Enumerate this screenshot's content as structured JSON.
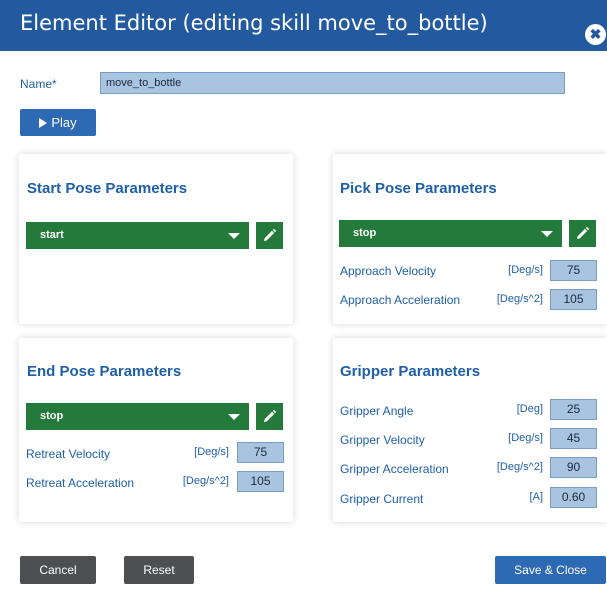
{
  "window": {
    "title": "Element Editor (editing skill move_to_bottle)",
    "close_glyph": "✖"
  },
  "name_field": {
    "label": "Name*",
    "value": "move_to_bottle"
  },
  "play_button": {
    "label": "Play",
    "icon": "play-icon"
  },
  "start_pose": {
    "title": "Start Pose Parameters",
    "selected": "start",
    "edit_icon": "pencil-icon"
  },
  "pick_pose": {
    "title": "Pick Pose Parameters",
    "selected": "stop",
    "edit_icon": "pencil-icon",
    "params": [
      {
        "label": "Approach Velocity",
        "unit": "[Deg/s]",
        "value": "75"
      },
      {
        "label": "Approach Acceleration",
        "unit": "[Deg/s^2]",
        "value": "105"
      }
    ]
  },
  "end_pose": {
    "title": "End Pose Parameters",
    "selected": "stop",
    "edit_icon": "pencil-icon",
    "params": [
      {
        "label": "Retreat Velocity",
        "unit": "[Deg/s]",
        "value": "75"
      },
      {
        "label": "Retreat Acceleration",
        "unit": "[Deg/s^2]",
        "value": "105"
      }
    ]
  },
  "gripper": {
    "title": "Gripper Parameters",
    "params": [
      {
        "label": "Gripper Angle",
        "unit": "[Deg]",
        "value": "25"
      },
      {
        "label": "Gripper Velocity",
        "unit": "[Deg/s]",
        "value": "45"
      },
      {
        "label": "Gripper Acceleration",
        "unit": "[Deg/s^2]",
        "value": "90"
      },
      {
        "label": "Gripper Current",
        "unit": "[A]",
        "value": "0.60"
      }
    ]
  },
  "footer": {
    "cancel_label": "Cancel",
    "reset_label": "Reset",
    "save_label": "Save & Close"
  },
  "colors": {
    "title_bar": "#235a9f",
    "accent_text": "#1f5fa8",
    "primary_button": "#2e69b3",
    "dropdown_green": "#237a3a",
    "secondary_button": "#4d4f51",
    "field_fill": "#a8c4e0"
  }
}
